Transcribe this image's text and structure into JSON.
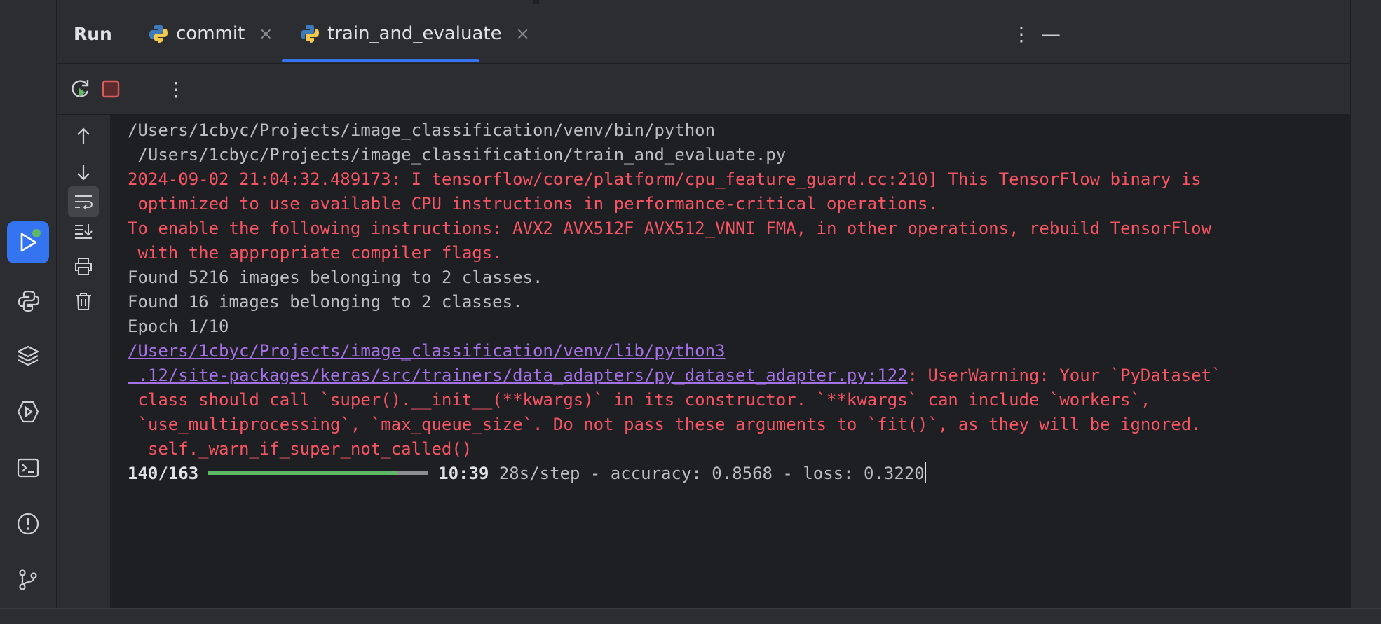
{
  "panel": {
    "title": "Run",
    "tabs": [
      {
        "label": "commit",
        "icon": "python-icon",
        "active": false
      },
      {
        "label": "train_and_evaluate",
        "icon": "python-icon",
        "active": true
      }
    ],
    "close_glyph": "×",
    "more_glyph": "⋮",
    "minimize_glyph": "—"
  },
  "colors": {
    "accent": "#3574f0",
    "error_text": "#f75464",
    "link_text": "#a571e6",
    "progress_fill": "#5fb865",
    "stop_button": "#db5c5c"
  },
  "console": {
    "lines": [
      "/Users/1cbyc/Projects/image_classification/venv/bin/python",
      " /Users/1cbyc/Projects/image_classification/train_and_evaluate.py",
      "2024-09-02 21:04:32.489173: I tensorflow/core/platform/cpu_feature_guard.cc:210] This TensorFlow binary is",
      " optimized to use available CPU instructions in performance-critical operations.",
      "To enable the following instructions: AVX2 AVX512F AVX512_VNNI FMA, in other operations, rebuild TensorFlow",
      " with the appropriate compiler flags.",
      "Found 5216 images belonging to 2 classes.",
      "Found 16 images belonging to 2 classes.",
      "Epoch 1/10",
      "/Users/1cbyc/Projects/image_classification/venv/lib/python3",
      " .12/site-packages/keras/src/trainers/data_adapters/py_dataset_adapter.py:122",
      ": UserWarning: Your `PyDataset`",
      " class should call `super().__init__(**kwargs)` in its constructor. `**kwargs` can include `workers`,",
      " `use_multiprocessing`, `max_queue_size`. Do not pass these arguments to `fit()`, as they will be ignored.",
      "  self._warn_if_super_not_called()"
    ],
    "progress": {
      "steps": "140/163",
      "fraction": 0.859,
      "eta": "10:39",
      "metrics": " 28s/step - accuracy: 0.8568 - loss: 0.3220"
    }
  }
}
